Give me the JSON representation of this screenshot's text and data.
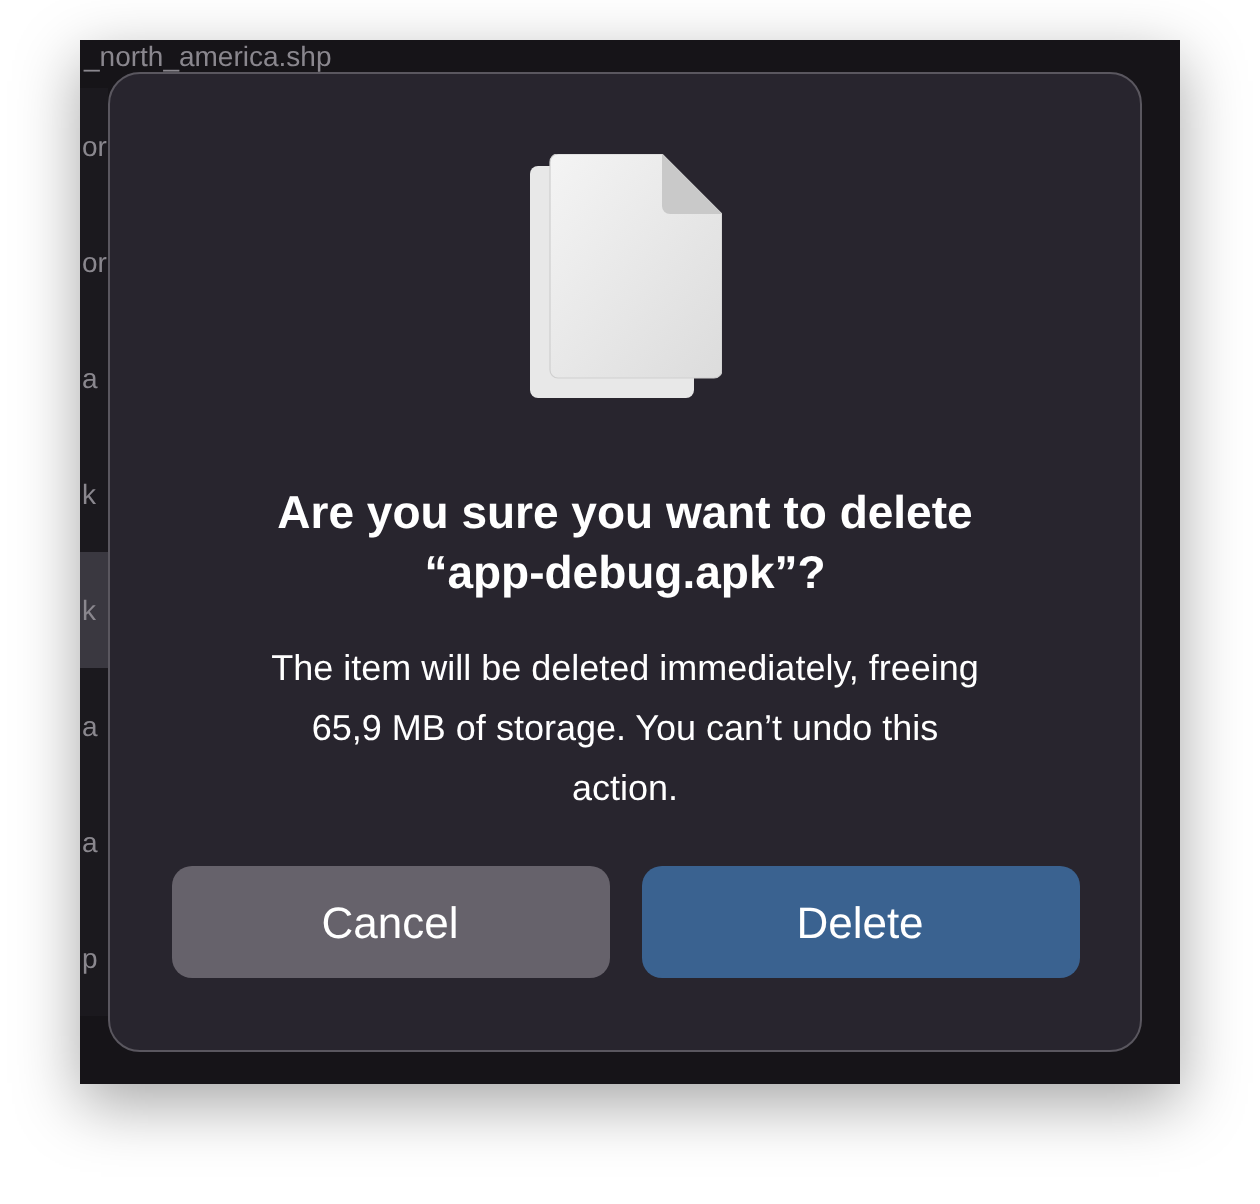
{
  "background_window": {
    "title": "_north_america.shp",
    "rows": [
      {
        "text": "or",
        "selected": false
      },
      {
        "text": "or",
        "selected": false
      },
      {
        "text": "a",
        "selected": false
      },
      {
        "text": "k",
        "selected": false
      },
      {
        "text": "k",
        "selected": true
      },
      {
        "text": "a",
        "selected": false
      },
      {
        "text": "a",
        "selected": false
      },
      {
        "text": "p",
        "selected": false
      }
    ]
  },
  "dialog": {
    "title": "Are you sure you want to delete “app-debug.apk”?",
    "message": "The item will be deleted immediately, freeing 65,9 MB of storage. You can’t undo this action.",
    "buttons": [
      {
        "label": "Cancel",
        "kind": "secondary"
      },
      {
        "label": "Delete",
        "kind": "primary"
      }
    ]
  }
}
